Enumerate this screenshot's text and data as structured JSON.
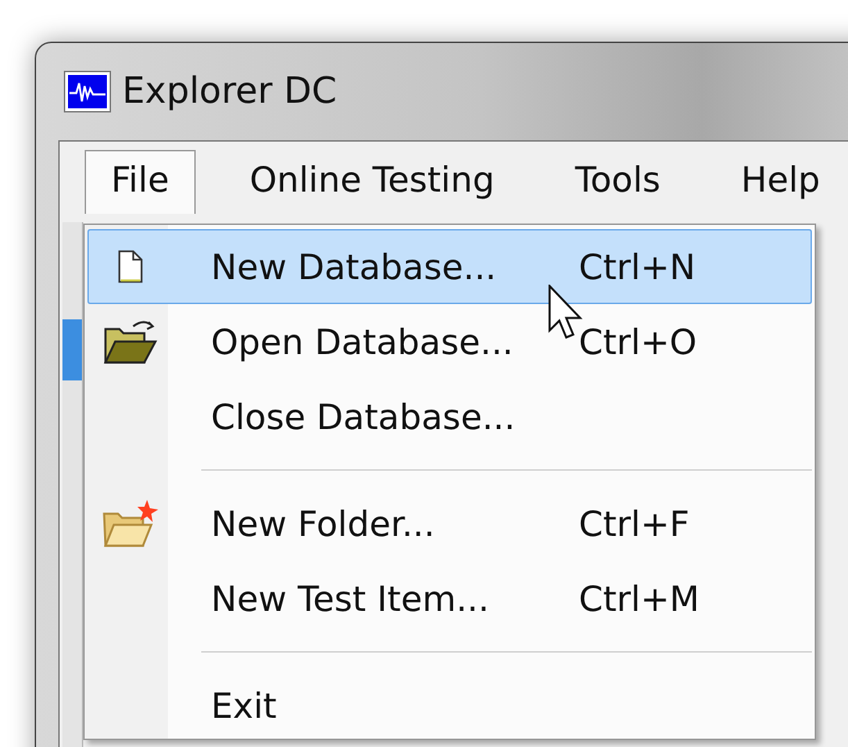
{
  "window": {
    "title": "Explorer DC"
  },
  "menu_bar": [
    {
      "label": "File",
      "selected": true
    },
    {
      "label": "Online Testing",
      "selected": false
    },
    {
      "label": "Tools",
      "selected": false
    },
    {
      "label": "Help",
      "selected": false
    }
  ],
  "file_menu": [
    {
      "kind": "item",
      "label": "New Database...",
      "shortcut": "Ctrl+N",
      "selected": true
    },
    {
      "kind": "item",
      "label": "Open Database...",
      "shortcut": "Ctrl+O",
      "selected": false
    },
    {
      "kind": "item",
      "label": "Close Database...",
      "selected": false
    },
    {
      "kind": "separator"
    },
    {
      "kind": "item",
      "label": "New Folder...",
      "shortcut": "Ctrl+F",
      "selected": false
    },
    {
      "kind": "item",
      "label": "New Test Item...",
      "shortcut": "Ctrl+M",
      "selected": false
    },
    {
      "kind": "separator"
    },
    {
      "kind": "item",
      "label": "Exit",
      "selected": false
    }
  ]
}
